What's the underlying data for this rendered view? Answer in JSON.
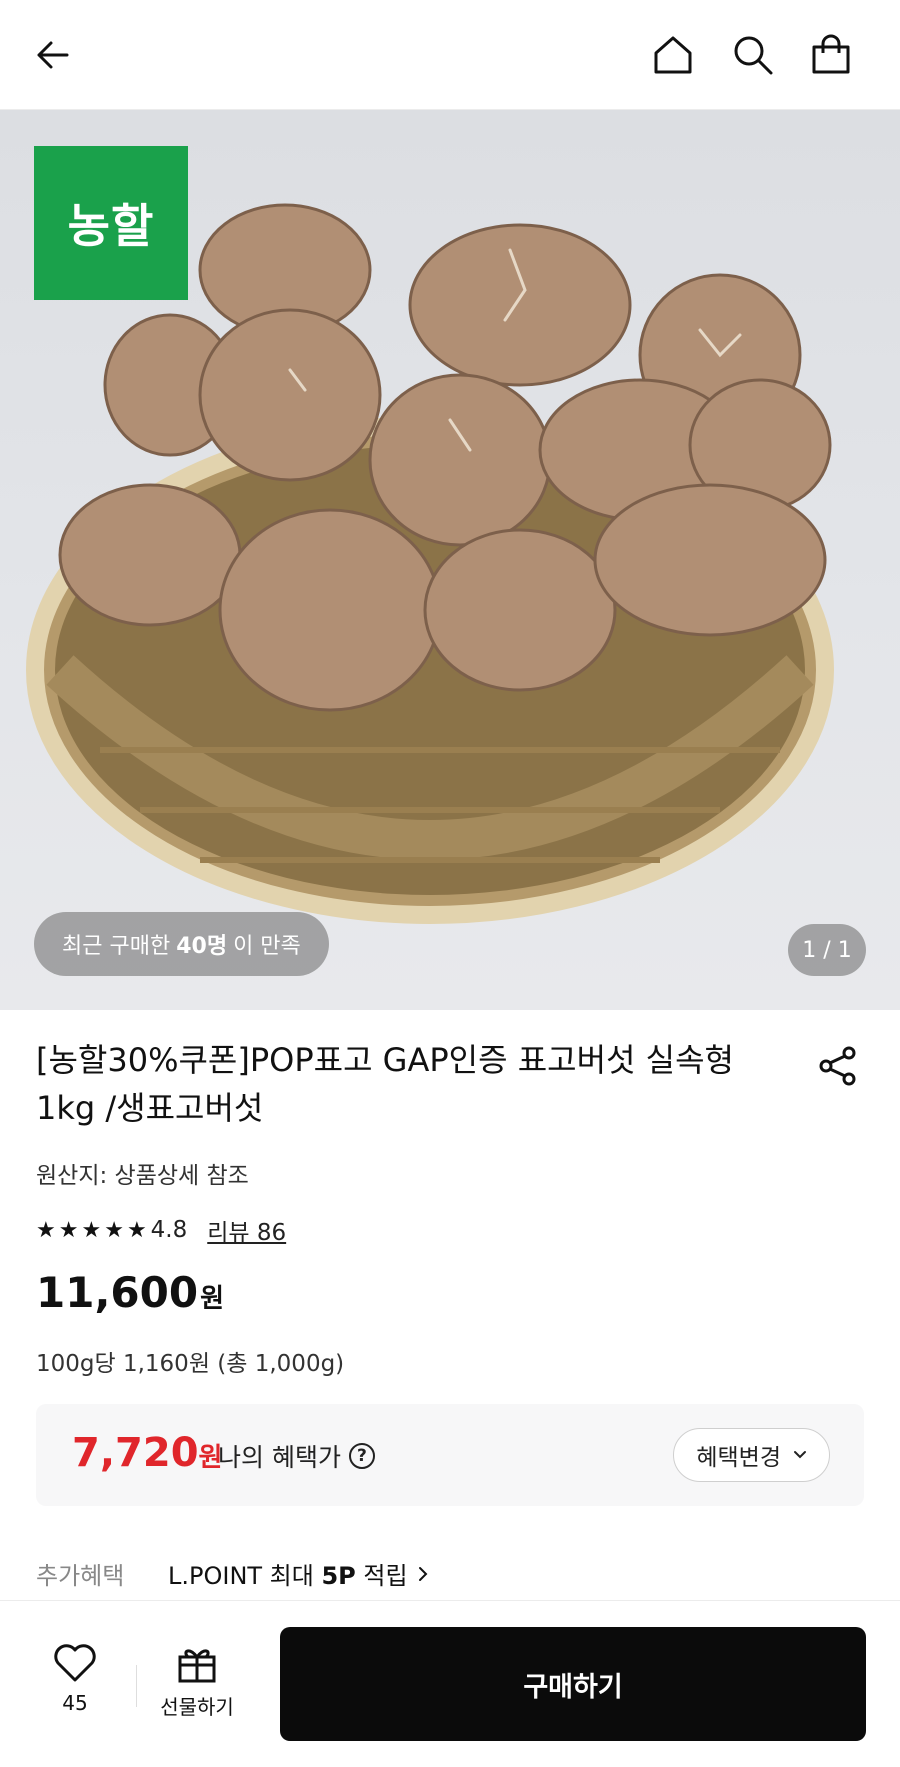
{
  "header": {
    "back_icon": "arrow-left-icon",
    "home_icon": "home-icon",
    "search_icon": "search-icon",
    "cart_icon": "shopping-bag-icon"
  },
  "hero": {
    "brand_badge": "농할",
    "brand_color": "#1aa14b",
    "purchase_pill": {
      "prefix": "최근 구매한 ",
      "count": "40명",
      "suffix": "이 만족"
    },
    "image_counter": "1 / 1"
  },
  "product": {
    "title": "[농할30%쿠폰]POP표고 GAP인증 표고버섯 실속형 1kg /생표고버섯",
    "origin": "원산지: 상품상세 참조",
    "rating": {
      "value": "4.8",
      "stars": 5,
      "review_label": "리뷰 86"
    },
    "price": "11,600",
    "currency": "원",
    "unit_price": "100g당 1,160원 (총 1,000g)"
  },
  "benefit": {
    "price": "7,720",
    "currency": "원",
    "label": "나의 혜택가",
    "help_icon": "question-circle-icon",
    "change_button": "혜택변경",
    "accent_color": "#e0262b"
  },
  "extra_benefit": {
    "label": "추가혜택",
    "value_prefix": "L.POINT 최대 ",
    "value_bold": "5P",
    "value_suffix": " 적립"
  },
  "bottom_bar": {
    "like_count": "45",
    "gift_label": "선물하기",
    "buy_button": "구매하기"
  }
}
